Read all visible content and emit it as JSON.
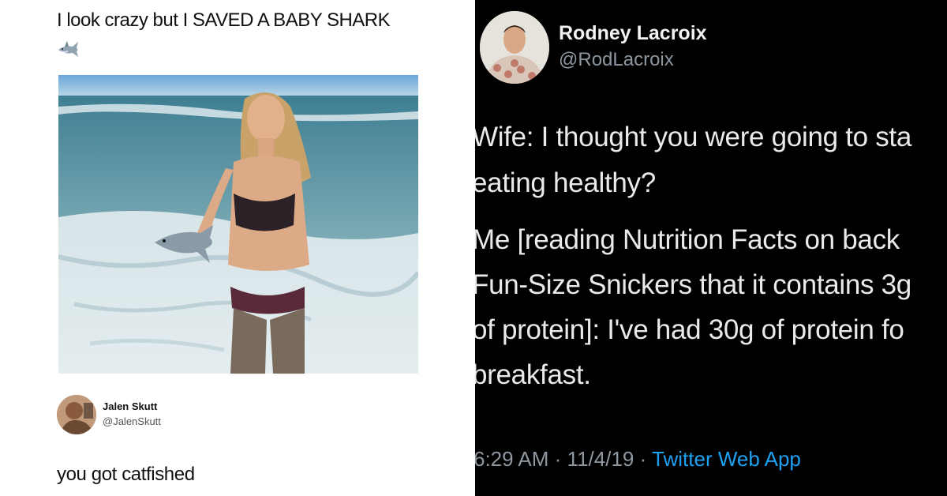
{
  "left_tweet": {
    "text": "I look crazy but I SAVED A BABY SHARK",
    "emoji_icon": "shark-icon",
    "photo_desc_icon": "beach-photo"
  },
  "reply": {
    "name": "Jalen Skutt",
    "handle": "@JalenSkutt",
    "text": "you got catfished"
  },
  "right_tweet": {
    "name": "Rodney Lacroix",
    "handle": "@RodLacroix",
    "lines": [
      "Wife: I thought you were going to sta",
      "eating healthy?",
      "Me [reading Nutrition Facts on back",
      "Fun-Size Snickers that it contains 3g",
      "of protein]: I've had 30g of protein fo",
      "breakfast."
    ],
    "time": "6:29 AM",
    "separator": "·",
    "date": "11/4/19",
    "source": "Twitter Web App"
  },
  "colors": {
    "link": "#1da1f2",
    "dark_bg": "#000000",
    "muted": "#8e979f"
  }
}
